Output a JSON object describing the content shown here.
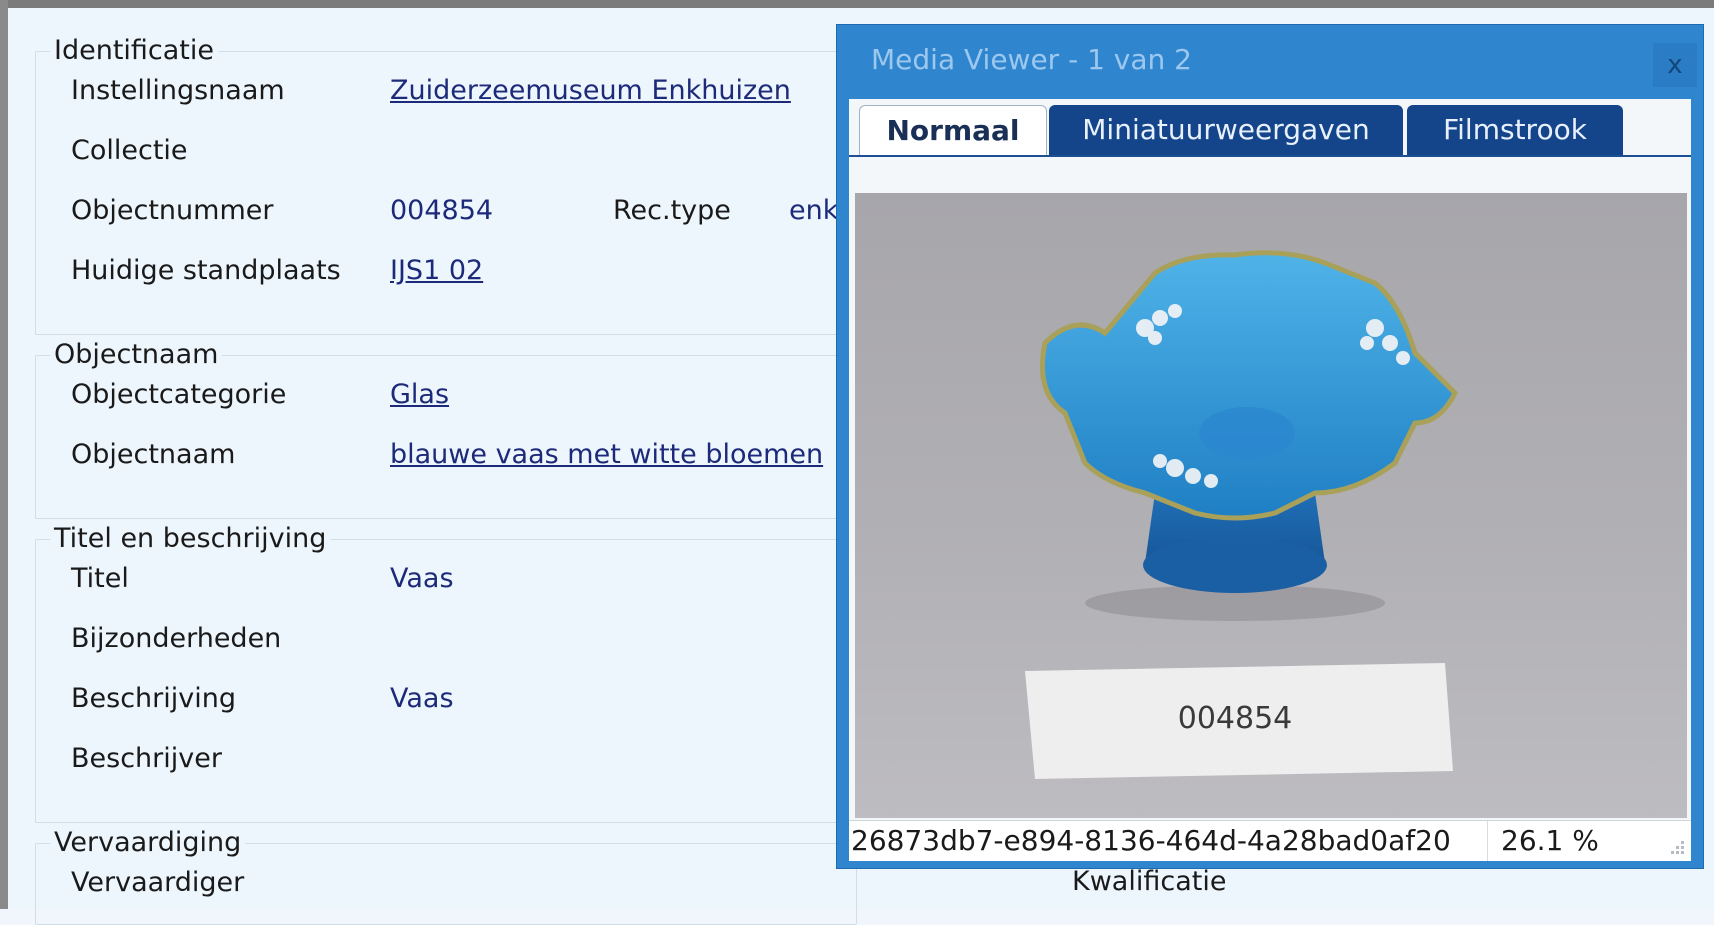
{
  "sections": {
    "identificatie": {
      "title": "Identificatie",
      "instellingsnaam_label": "Instellingsnaam",
      "instellingsnaam_value": "Zuiderzeemuseum Enkhuizen",
      "collectie_label": "Collectie",
      "objectnummer_label": "Objectnummer",
      "objectnummer_value": "004854",
      "rectype_label": "Rec.type",
      "rectype_value": "enk",
      "standplaats_label": "Huidige standplaats",
      "standplaats_value": "IJS1 02"
    },
    "objectnaam": {
      "title": "Objectnaam",
      "categorie_label": "Objectcategorie",
      "categorie_value": "Glas",
      "naam_label": "Objectnaam",
      "naam_value": "blauwe vaas met witte bloemen"
    },
    "titel": {
      "title": "Titel en beschrijving",
      "titel_label": "Titel",
      "titel_value": "Vaas",
      "bijzonderheden_label": "Bijzonderheden",
      "beschrijving_label": "Beschrijving",
      "beschrijving_value": "Vaas",
      "beschrijver_label": "Beschrijver"
    },
    "vervaardiging": {
      "title": "Vervaardiging",
      "vervaardiger_label": "Vervaardiger",
      "kwalificatie_label": "Kwalificatie"
    }
  },
  "viewer": {
    "title": "Media Viewer - 1 van 2",
    "close_label": "x",
    "tabs": [
      "Normaal",
      "Miniatuurweergaven",
      "Filmstrook"
    ],
    "active_tab": "Normaal",
    "image_tag_text": "004854",
    "media_id": "26873db7-e894-8136-464d-4a28bad0af20",
    "zoom": "26.1 %"
  }
}
